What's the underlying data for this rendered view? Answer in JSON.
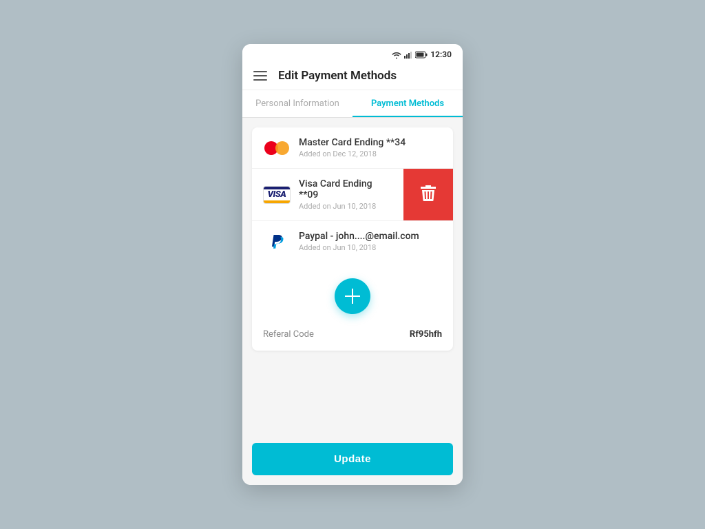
{
  "statusBar": {
    "time": "12:30"
  },
  "topBar": {
    "title": "Edit Payment Methods"
  },
  "tabs": [
    {
      "id": "personal",
      "label": "Personal Information",
      "active": false
    },
    {
      "id": "payment",
      "label": "Payment Methods",
      "active": true
    }
  ],
  "paymentMethods": [
    {
      "id": 1,
      "type": "mastercard",
      "name": "Master Card Ending **34",
      "date": "Added on Dec 12, 2018",
      "swiped": false
    },
    {
      "id": 2,
      "type": "visa",
      "name": "Visa Card Ending **09",
      "date": "Added on Jun 10, 2018",
      "swiped": true
    },
    {
      "id": 3,
      "type": "paypal",
      "name": "Paypal - john....@email.com",
      "date": "Added on Jun 10, 2018",
      "swiped": false
    }
  ],
  "addButton": {
    "label": "+"
  },
  "referral": {
    "label": "Referal Code",
    "value": "Rf95hfh"
  },
  "updateButton": {
    "label": "Update"
  },
  "colors": {
    "accent": "#00bcd4",
    "deleteRed": "#e53935"
  }
}
